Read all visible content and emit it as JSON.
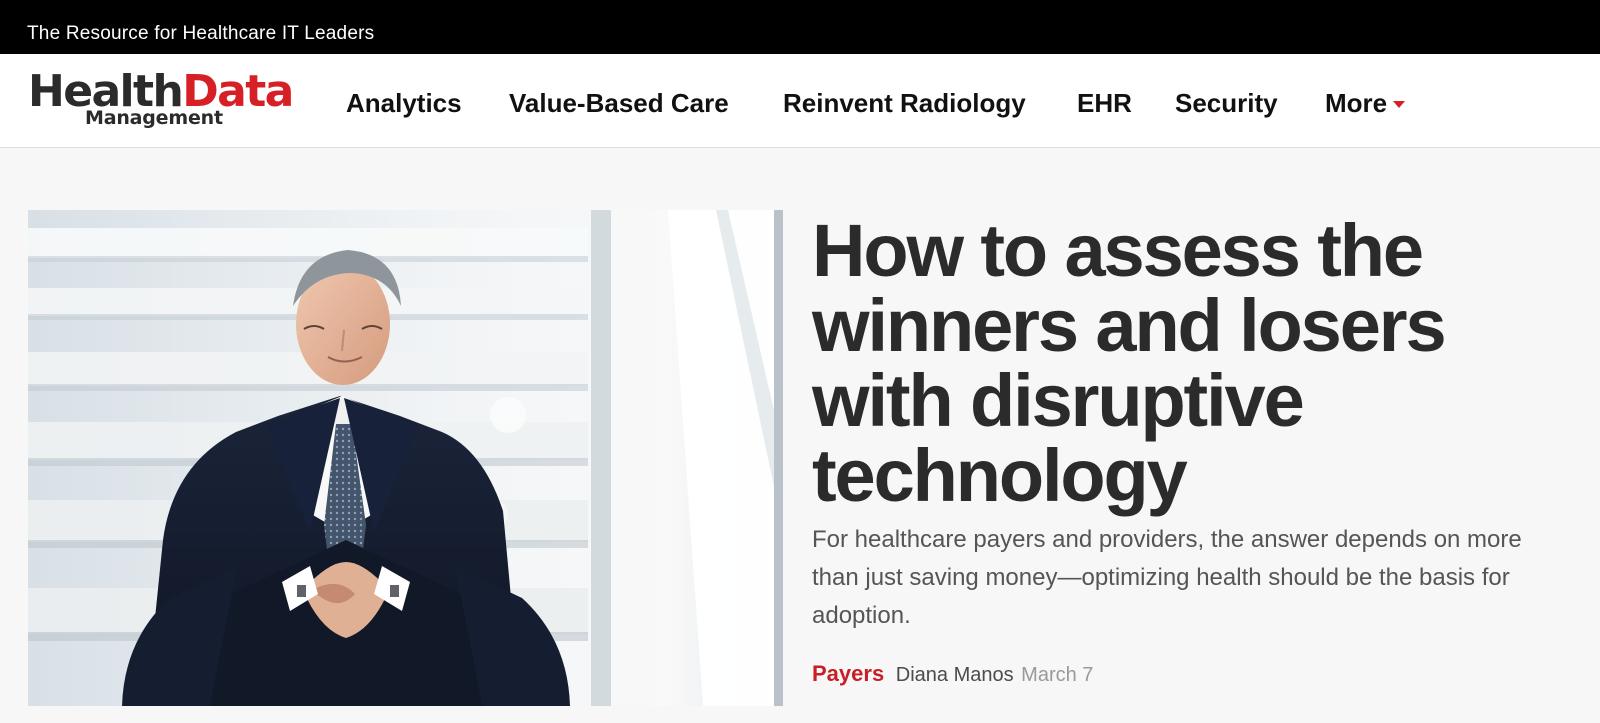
{
  "topbar": {
    "tagline": "The Resource for Healthcare IT Leaders"
  },
  "logo": {
    "health": "Health",
    "data": "Data",
    "management": "Management"
  },
  "nav": {
    "items": [
      {
        "label": "Analytics"
      },
      {
        "label": "Value-Based Care"
      },
      {
        "label": "Reinvent Radiology"
      },
      {
        "label": "EHR"
      },
      {
        "label": "Security"
      },
      {
        "label": "More"
      }
    ]
  },
  "article": {
    "headline": "How to assess the winners and losers with disruptive technology",
    "dek": "For healthcare payers and providers, the answer depends on more than just saving money—optimizing health should be the basis for adoption.",
    "category": "Payers",
    "author": "Diana Manos",
    "date": "March 7"
  },
  "colors": {
    "brand_red": "#d71f26",
    "text_dark": "#2b2b2b",
    "background": "#f7f7f7"
  },
  "icons": {
    "more_menu": "chevron-down-icon"
  }
}
